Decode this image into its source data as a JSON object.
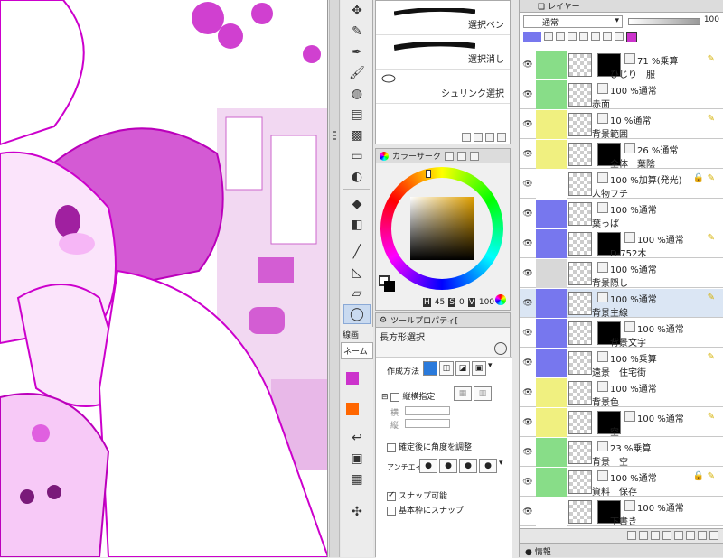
{
  "subtools": {
    "items": [
      {
        "label": "選択ペン"
      },
      {
        "label": "選択消し"
      },
      {
        "label": "シュリンク選択"
      }
    ]
  },
  "color_panel": {
    "title": "カラーサーク",
    "h_value": "45",
    "s_value": "0",
    "v_value": "100",
    "h_label": "H",
    "s_label": "S",
    "v_label": "V"
  },
  "tool_property": {
    "title": "ツールプロパティ[",
    "tool_name": "長方形選択",
    "mode_label": "作成方法",
    "aspect_label": "縦横指定",
    "width_label": "横",
    "height_label": "縦",
    "angle_label": "確定後に角度を調整",
    "antialias_label": "アンチエイリ",
    "snap_label": "スナップ可能",
    "basic_frame_snap_label": "基本枠にスナップ",
    "line_label": "線画",
    "name_label": "ネーム"
  },
  "layers": {
    "tab_label": "レイヤー",
    "blend_mode": "通常",
    "opacity": "100",
    "info_tab_label": "情報",
    "rows": [
      {
        "percent": "71 %乗算",
        "name": "ひじり　服"
      },
      {
        "percent": "100 %通常",
        "name": "赤面"
      },
      {
        "percent": "10 %通常",
        "name": "背景範囲"
      },
      {
        "percent": "26 %通常",
        "name": "全体　葉陰"
      },
      {
        "percent": "100 %加算(発光)",
        "name": "人物フチ"
      },
      {
        "percent": "100 %通常",
        "name": "葉っぱ"
      },
      {
        "percent": "100 %通常",
        "name": "D-752木"
      },
      {
        "percent": "100 %通常",
        "name": "背景隠し"
      },
      {
        "percent": "100 %通常",
        "name": "背景主線"
      },
      {
        "percent": "100 %通常",
        "name": "背景文字"
      },
      {
        "percent": "100 %乗算",
        "name": "遠景　住宅街"
      },
      {
        "percent": "100 %通常",
        "name": "背景色"
      },
      {
        "percent": "100 %通常",
        "name": "空"
      },
      {
        "percent": "23 %乗算",
        "name": "背景　空"
      },
      {
        "percent": "100 %通常",
        "name": "資料　保存"
      },
      {
        "percent": "100 %通常",
        "name": "下書き"
      }
    ]
  },
  "colors": {
    "accent": "#c8c",
    "magenta": "#cc33cc",
    "green": "#88dd88",
    "yellow": "#f0f080",
    "blue": "#7777ee",
    "orange": "#ff6600"
  }
}
